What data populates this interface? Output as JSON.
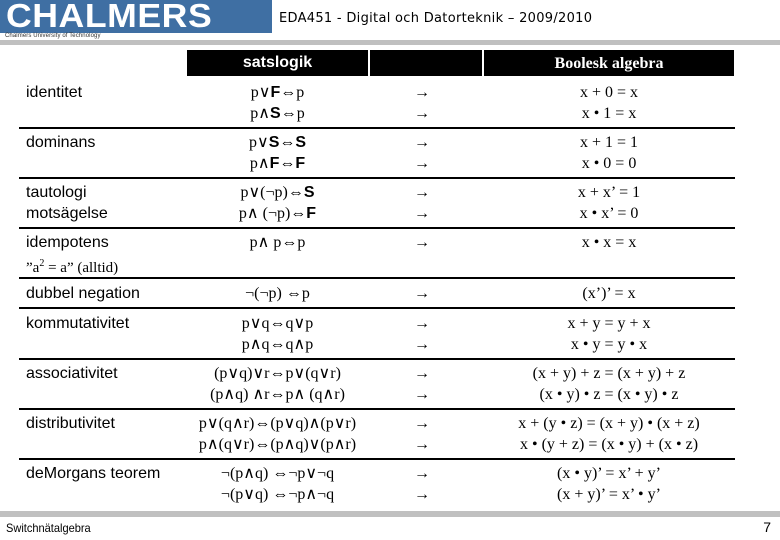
{
  "header": {
    "logo_text": "CHALMERS",
    "logo_subtitle": "Chalmers University of Technology",
    "course_title": "EDA451 - Digital och Datorteknik – 2009/2010",
    "brand_color": "#3f6fa3"
  },
  "table": {
    "columns": [
      "",
      "satslogik",
      "",
      "Boolesk algebra"
    ],
    "rows": [
      {
        "label": "identitet",
        "label2": "",
        "logic": [
          "p∨F⇔p",
          "p∧S⇔p"
        ],
        "arrows": [
          "→",
          "→"
        ],
        "boolean": [
          "x + 0 = x",
          "x • 1 = x"
        ]
      },
      {
        "label": "dominans",
        "label2": "",
        "logic": [
          "p∨S⇔S",
          "p∧F⇔F"
        ],
        "arrows": [
          "→",
          "→"
        ],
        "boolean": [
          "x + 1 = 1",
          "x • 0 = 0"
        ]
      },
      {
        "label": "tautologi",
        "label2": "motsägelse",
        "logic": [
          "p∨(¬p)⇔S",
          "p∧ (¬p)⇔F"
        ],
        "arrows": [
          "→",
          "→"
        ],
        "boolean": [
          "x + x’ = 1",
          "x • x’ = 0"
        ]
      },
      {
        "label": "idempotens",
        "label2": "”a2 = a” (alltid)",
        "logic": [
          "p∧ p⇔p",
          ""
        ],
        "arrows": [
          "→",
          ""
        ],
        "boolean": [
          "x • x = x",
          ""
        ]
      },
      {
        "label": "dubbel negation",
        "label2": "",
        "logic": [
          "¬(¬p) ⇔p",
          ""
        ],
        "arrows": [
          "→",
          ""
        ],
        "boolean": [
          "(x’)’ = x",
          ""
        ]
      },
      {
        "label": "kommutativitet",
        "label2": "",
        "logic": [
          "p∨q⇔q∨p",
          "p∧q⇔q∧p"
        ],
        "arrows": [
          "→",
          "→"
        ],
        "boolean": [
          "x + y = y + x",
          "x • y = y • x"
        ]
      },
      {
        "label": "associativitet",
        "label2": "",
        "logic": [
          "(p∨q)∨r⇔p∨(q∨r)",
          "(p∧q) ∧r⇔p∧ (q∧r)"
        ],
        "arrows": [
          "→",
          "→"
        ],
        "boolean": [
          "(x + y) + z = (x + y) + z",
          "(x • y) • z = (x • y) • z"
        ]
      },
      {
        "label": "distributivitet",
        "label2": "",
        "logic": [
          "p∨(q∧r)⇔(p∨q)∧(p∨r)",
          "p∧(q∨r)⇔(p∧q)∨(p∧r)"
        ],
        "arrows": [
          "→",
          "→"
        ],
        "boolean": [
          "x + (y • z) = (x + y) • (x + z)",
          "x • (y + z) = (x • y) + (x • z)"
        ]
      },
      {
        "label": "deMorgans teorem",
        "label2": "",
        "logic": [
          "¬(p∧q) ⇔¬p∨¬q",
          "¬(p∨q) ⇔¬p∧¬q"
        ],
        "arrows": [
          "→",
          "→"
        ],
        "boolean": [
          "(x • y)’ =  x’ + y’",
          "(x + y)’ =  x’ • y’"
        ]
      }
    ]
  },
  "footer": {
    "left": "Switchnätalgebra",
    "page_number": "7"
  }
}
